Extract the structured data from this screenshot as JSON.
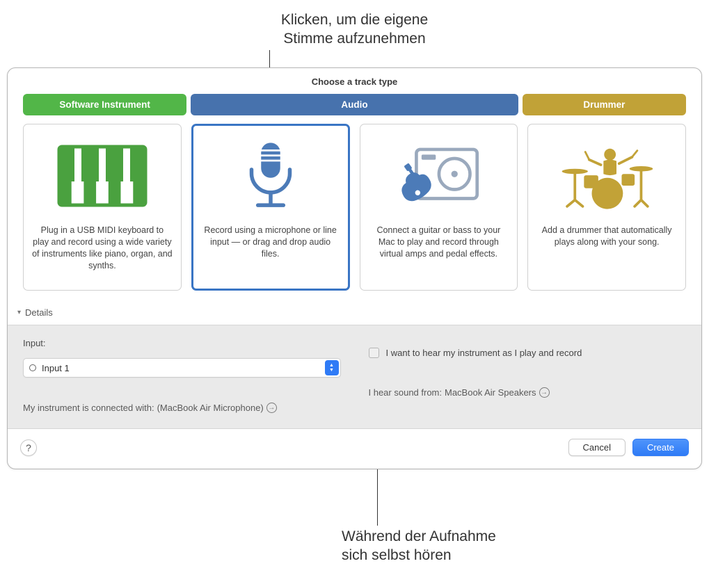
{
  "callouts": {
    "top": "Klicken, um die eigene\nStimme aufzunehmen",
    "bottom": "Während der Aufnahme\nsich selbst hören"
  },
  "header": {
    "title": "Choose a track type"
  },
  "tabs": {
    "software": "Software Instrument",
    "audio": "Audio",
    "drummer": "Drummer"
  },
  "cards": {
    "software": "Plug in a USB MIDI keyboard to play and record using a wide variety of instruments like piano, organ, and synths.",
    "mic": "Record using a microphone or line input — or drag and drop audio files.",
    "guitar": "Connect a guitar or bass to your Mac to play and record through virtual amps and pedal effects.",
    "drummer": "Add a drummer that automatically plays along with your song."
  },
  "details": {
    "section_label": "Details",
    "input_label": "Input:",
    "input_value": "Input 1",
    "connected_prefix": "My instrument is connected with:",
    "connected_device": "(MacBook Air Microphone)",
    "monitor_label": "I want to hear my instrument as I play and record",
    "hear_prefix": "I hear sound from:",
    "hear_device": "MacBook Air Speakers"
  },
  "footer": {
    "cancel": "Cancel",
    "create": "Create"
  }
}
